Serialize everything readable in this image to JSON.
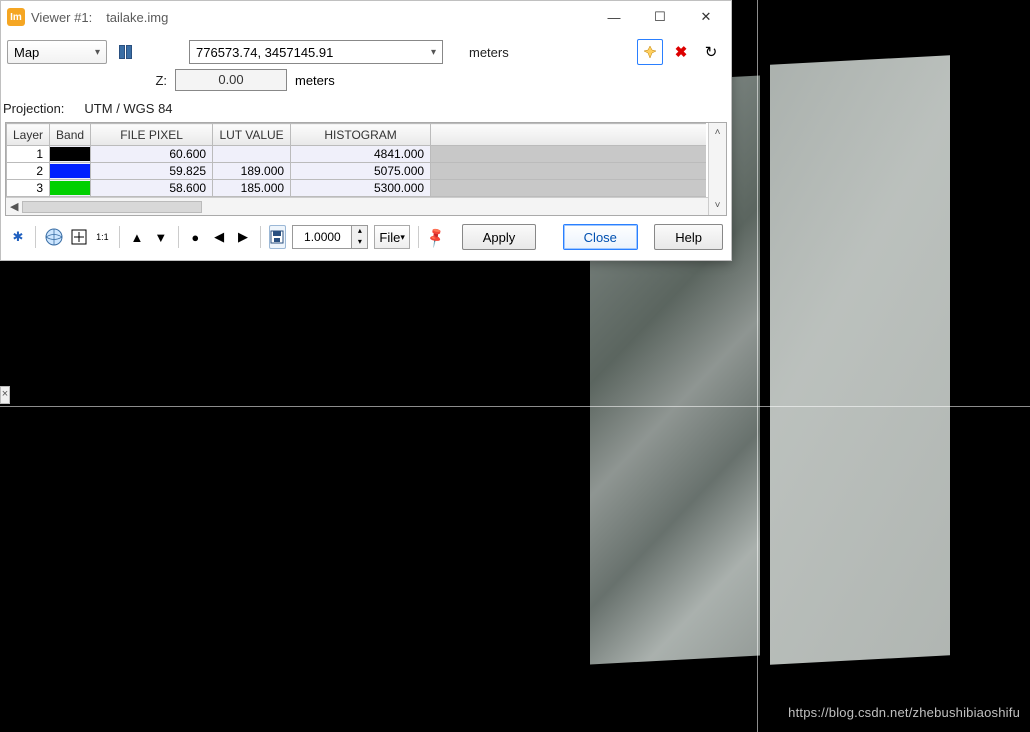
{
  "window": {
    "title": "Viewer #1:",
    "filename": "tailake.img"
  },
  "toolbar": {
    "mode_label": "Map",
    "coords": "776573.74, 3457145.91",
    "coord_units": "meters",
    "z_label": "Z:",
    "z_value": "0.00",
    "z_units": "meters"
  },
  "projection": {
    "label": "Projection:",
    "value": "UTM / WGS 84"
  },
  "table": {
    "headers": {
      "layer": "Layer",
      "band": "Band",
      "file_pixel": "FILE PIXEL",
      "lut_value": "LUT VALUE",
      "histogram": "HISTOGRAM"
    },
    "rows": [
      {
        "layer": "1",
        "band_color": "blk",
        "file_pixel": "60.600",
        "lut_value": "",
        "histogram": "4841.000"
      },
      {
        "layer": "2",
        "band_color": "blu",
        "file_pixel": "59.825",
        "lut_value": "189.000",
        "histogram": "5075.000"
      },
      {
        "layer": "3",
        "band_color": "grn",
        "file_pixel": "58.600",
        "lut_value": "185.000",
        "histogram": "5300.000"
      }
    ]
  },
  "bottombar": {
    "zoom_value": "1.0000",
    "file_label": "File",
    "apply_label": "Apply",
    "close_label": "Close",
    "help_label": "Help"
  },
  "watermark": "https://blog.csdn.net/zhebushibiaoshifu",
  "icons": {
    "asterisk": "✱",
    "globe": "🌐",
    "plusbox": "⊕",
    "one_one": "1:1",
    "up_tri": "▲",
    "down_tri": "▼",
    "circle": "●",
    "play_left": "◀",
    "play_right": "▶",
    "save": "💾",
    "pin": "📌",
    "refresh": "↻",
    "x": "✖",
    "chev": "▾",
    "min": "—",
    "max": "☐",
    "closewin": "✕",
    "left": "◀",
    "right": "▶",
    "up": "˄",
    "down": "˅"
  }
}
